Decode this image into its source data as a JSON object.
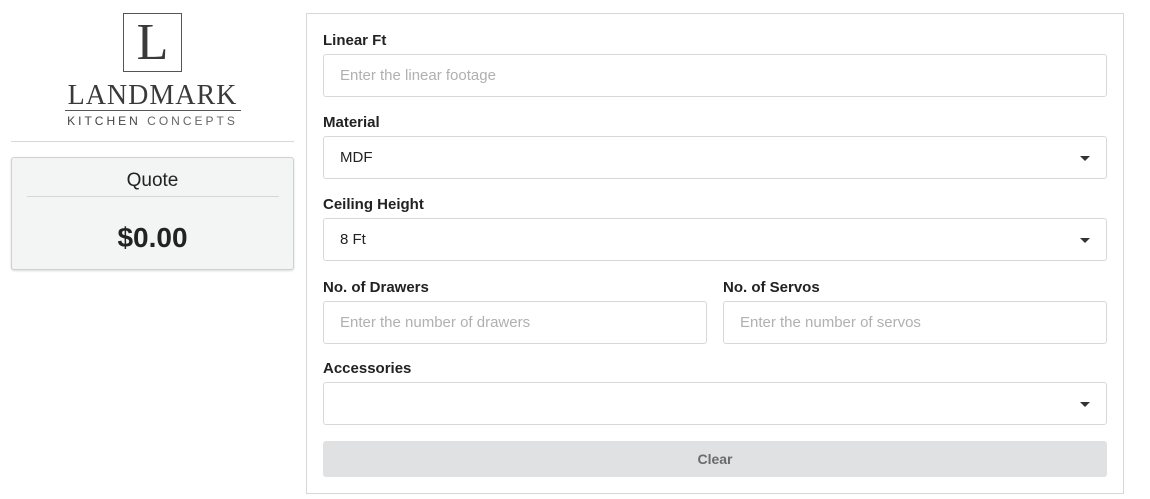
{
  "logo": {
    "mark": "L",
    "name": "LANDMARK",
    "sub_primary": "KITCHEN",
    "sub_secondary": "CONCEPTS"
  },
  "quote": {
    "title": "Quote",
    "value": "$0.00"
  },
  "form": {
    "linear_ft": {
      "label": "Linear Ft",
      "placeholder": "Enter the linear footage",
      "value": ""
    },
    "material": {
      "label": "Material",
      "value": "MDF",
      "icon": "chevron-down-icon"
    },
    "ceiling_height": {
      "label": "Ceiling Height",
      "value": "8 Ft",
      "icon": "chevron-down-icon"
    },
    "drawers": {
      "label": "No. of Drawers",
      "placeholder": "Enter the number of drawers",
      "value": ""
    },
    "servos": {
      "label": "No. of Servos",
      "placeholder": "Enter the number of servos",
      "value": ""
    },
    "accessories": {
      "label": "Accessories",
      "value": "",
      "icon": "chevron-down-icon"
    },
    "clear_label": "Clear"
  }
}
